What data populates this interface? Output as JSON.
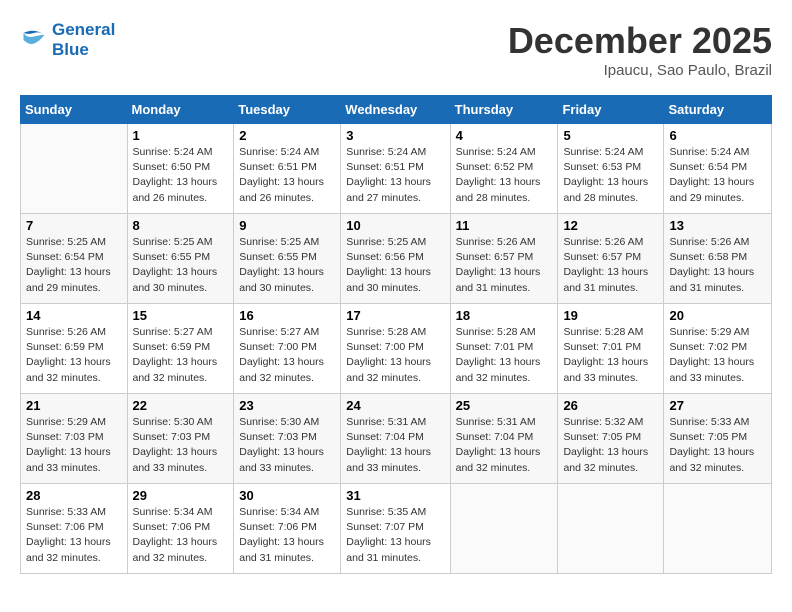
{
  "header": {
    "logo_line1": "General",
    "logo_line2": "Blue",
    "month": "December 2025",
    "location": "Ipaucu, Sao Paulo, Brazil"
  },
  "weekdays": [
    "Sunday",
    "Monday",
    "Tuesday",
    "Wednesday",
    "Thursday",
    "Friday",
    "Saturday"
  ],
  "weeks": [
    [
      {
        "day": "",
        "detail": ""
      },
      {
        "day": "1",
        "detail": "Sunrise: 5:24 AM\nSunset: 6:50 PM\nDaylight: 13 hours\nand 26 minutes."
      },
      {
        "day": "2",
        "detail": "Sunrise: 5:24 AM\nSunset: 6:51 PM\nDaylight: 13 hours\nand 26 minutes."
      },
      {
        "day": "3",
        "detail": "Sunrise: 5:24 AM\nSunset: 6:51 PM\nDaylight: 13 hours\nand 27 minutes."
      },
      {
        "day": "4",
        "detail": "Sunrise: 5:24 AM\nSunset: 6:52 PM\nDaylight: 13 hours\nand 28 minutes."
      },
      {
        "day": "5",
        "detail": "Sunrise: 5:24 AM\nSunset: 6:53 PM\nDaylight: 13 hours\nand 28 minutes."
      },
      {
        "day": "6",
        "detail": "Sunrise: 5:24 AM\nSunset: 6:54 PM\nDaylight: 13 hours\nand 29 minutes."
      }
    ],
    [
      {
        "day": "7",
        "detail": "Sunrise: 5:25 AM\nSunset: 6:54 PM\nDaylight: 13 hours\nand 29 minutes."
      },
      {
        "day": "8",
        "detail": "Sunrise: 5:25 AM\nSunset: 6:55 PM\nDaylight: 13 hours\nand 30 minutes."
      },
      {
        "day": "9",
        "detail": "Sunrise: 5:25 AM\nSunset: 6:55 PM\nDaylight: 13 hours\nand 30 minutes."
      },
      {
        "day": "10",
        "detail": "Sunrise: 5:25 AM\nSunset: 6:56 PM\nDaylight: 13 hours\nand 30 minutes."
      },
      {
        "day": "11",
        "detail": "Sunrise: 5:26 AM\nSunset: 6:57 PM\nDaylight: 13 hours\nand 31 minutes."
      },
      {
        "day": "12",
        "detail": "Sunrise: 5:26 AM\nSunset: 6:57 PM\nDaylight: 13 hours\nand 31 minutes."
      },
      {
        "day": "13",
        "detail": "Sunrise: 5:26 AM\nSunset: 6:58 PM\nDaylight: 13 hours\nand 31 minutes."
      }
    ],
    [
      {
        "day": "14",
        "detail": "Sunrise: 5:26 AM\nSunset: 6:59 PM\nDaylight: 13 hours\nand 32 minutes."
      },
      {
        "day": "15",
        "detail": "Sunrise: 5:27 AM\nSunset: 6:59 PM\nDaylight: 13 hours\nand 32 minutes."
      },
      {
        "day": "16",
        "detail": "Sunrise: 5:27 AM\nSunset: 7:00 PM\nDaylight: 13 hours\nand 32 minutes."
      },
      {
        "day": "17",
        "detail": "Sunrise: 5:28 AM\nSunset: 7:00 PM\nDaylight: 13 hours\nand 32 minutes."
      },
      {
        "day": "18",
        "detail": "Sunrise: 5:28 AM\nSunset: 7:01 PM\nDaylight: 13 hours\nand 32 minutes."
      },
      {
        "day": "19",
        "detail": "Sunrise: 5:28 AM\nSunset: 7:01 PM\nDaylight: 13 hours\nand 33 minutes."
      },
      {
        "day": "20",
        "detail": "Sunrise: 5:29 AM\nSunset: 7:02 PM\nDaylight: 13 hours\nand 33 minutes."
      }
    ],
    [
      {
        "day": "21",
        "detail": "Sunrise: 5:29 AM\nSunset: 7:03 PM\nDaylight: 13 hours\nand 33 minutes."
      },
      {
        "day": "22",
        "detail": "Sunrise: 5:30 AM\nSunset: 7:03 PM\nDaylight: 13 hours\nand 33 minutes."
      },
      {
        "day": "23",
        "detail": "Sunrise: 5:30 AM\nSunset: 7:03 PM\nDaylight: 13 hours\nand 33 minutes."
      },
      {
        "day": "24",
        "detail": "Sunrise: 5:31 AM\nSunset: 7:04 PM\nDaylight: 13 hours\nand 33 minutes."
      },
      {
        "day": "25",
        "detail": "Sunrise: 5:31 AM\nSunset: 7:04 PM\nDaylight: 13 hours\nand 32 minutes."
      },
      {
        "day": "26",
        "detail": "Sunrise: 5:32 AM\nSunset: 7:05 PM\nDaylight: 13 hours\nand 32 minutes."
      },
      {
        "day": "27",
        "detail": "Sunrise: 5:33 AM\nSunset: 7:05 PM\nDaylight: 13 hours\nand 32 minutes."
      }
    ],
    [
      {
        "day": "28",
        "detail": "Sunrise: 5:33 AM\nSunset: 7:06 PM\nDaylight: 13 hours\nand 32 minutes."
      },
      {
        "day": "29",
        "detail": "Sunrise: 5:34 AM\nSunset: 7:06 PM\nDaylight: 13 hours\nand 32 minutes."
      },
      {
        "day": "30",
        "detail": "Sunrise: 5:34 AM\nSunset: 7:06 PM\nDaylight: 13 hours\nand 31 minutes."
      },
      {
        "day": "31",
        "detail": "Sunrise: 5:35 AM\nSunset: 7:07 PM\nDaylight: 13 hours\nand 31 minutes."
      },
      {
        "day": "",
        "detail": ""
      },
      {
        "day": "",
        "detail": ""
      },
      {
        "day": "",
        "detail": ""
      }
    ]
  ]
}
